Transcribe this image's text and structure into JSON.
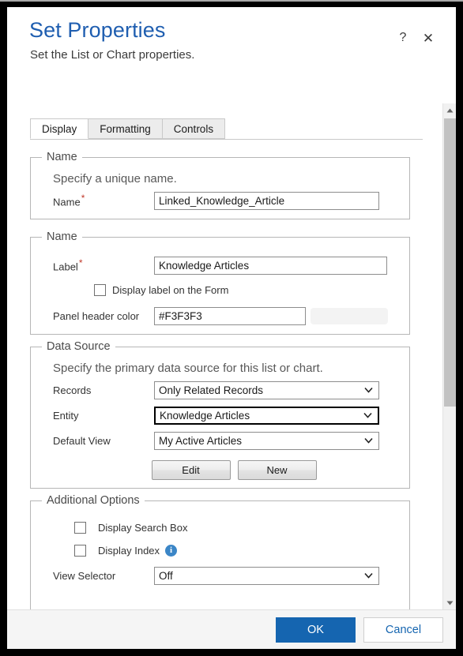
{
  "dialog": {
    "title": "Set Properties",
    "subtitle": "Set the List or Chart properties.",
    "help_icon": "?",
    "close_icon": "✕"
  },
  "tabs": [
    {
      "label": "Display",
      "active": true
    },
    {
      "label": "Formatting",
      "active": false
    },
    {
      "label": "Controls",
      "active": false
    }
  ],
  "sections": {
    "name_unique": {
      "legend": "Name",
      "description": "Specify a unique name.",
      "name_label": "Name",
      "required_marker": "*",
      "name_value": "Linked_Knowledge_Article"
    },
    "name_label": {
      "legend": "Name",
      "label_label": "Label",
      "required_marker": "*",
      "label_value": "Knowledge Articles",
      "display_label_checkbox": "Display label on the Form",
      "display_label_checked": false,
      "panel_header_color_label": "Panel header color",
      "panel_header_color_value": "#F3F3F3",
      "panel_header_color_swatch": "#F3F3F3"
    },
    "data_source": {
      "legend": "Data Source",
      "description": "Specify the primary data source for this list or chart.",
      "records_label": "Records",
      "records_value": "Only Related Records",
      "entity_label": "Entity",
      "entity_value": "Knowledge Articles",
      "default_view_label": "Default View",
      "default_view_value": "My Active Articles",
      "edit_button": "Edit",
      "new_button": "New"
    },
    "additional_options": {
      "legend": "Additional Options",
      "display_search_box_label": "Display Search Box",
      "display_search_box_checked": false,
      "display_index_label": "Display Index",
      "display_index_checked": false,
      "display_index_info_icon": "i",
      "view_selector_label": "View Selector",
      "view_selector_value": "Off"
    }
  },
  "footer": {
    "ok_label": "OK",
    "cancel_label": "Cancel"
  },
  "colors": {
    "title_blue": "#1f5eb0",
    "primary_button": "#1565b0",
    "required_red": "#c0392b",
    "info_blue": "#3b86c7"
  },
  "scrollbar": {
    "up_arrow": "▲",
    "down_arrow": "▼"
  }
}
